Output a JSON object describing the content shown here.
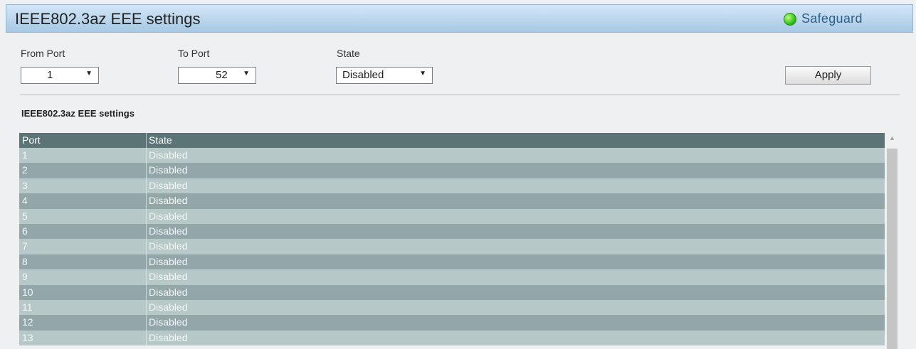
{
  "header": {
    "title": "IEEE802.3az EEE settings",
    "status_label": "Safeguard",
    "status_color": "#37c21c"
  },
  "form": {
    "from_port": {
      "label": "From Port",
      "value": "1"
    },
    "to_port": {
      "label": "To Port",
      "value": "52"
    },
    "state": {
      "label": "State",
      "value": "Disabled"
    },
    "apply_label": "Apply"
  },
  "section_title": "IEEE802.3az EEE settings",
  "table": {
    "columns": [
      "Port",
      "State"
    ],
    "rows": [
      {
        "port": "1",
        "state": "Disabled"
      },
      {
        "port": "2",
        "state": "Disabled"
      },
      {
        "port": "3",
        "state": "Disabled"
      },
      {
        "port": "4",
        "state": "Disabled"
      },
      {
        "port": "5",
        "state": "Disabled"
      },
      {
        "port": "6",
        "state": "Disabled"
      },
      {
        "port": "7",
        "state": "Disabled"
      },
      {
        "port": "8",
        "state": "Disabled"
      },
      {
        "port": "9",
        "state": "Disabled"
      },
      {
        "port": "10",
        "state": "Disabled"
      },
      {
        "port": "11",
        "state": "Disabled"
      },
      {
        "port": "12",
        "state": "Disabled"
      },
      {
        "port": "13",
        "state": "Disabled"
      }
    ]
  },
  "icons": {
    "status": "green-status-dot-icon",
    "dropdown": "chevron-down-icon",
    "scroll_up": "scroll-up-arrow-icon"
  }
}
